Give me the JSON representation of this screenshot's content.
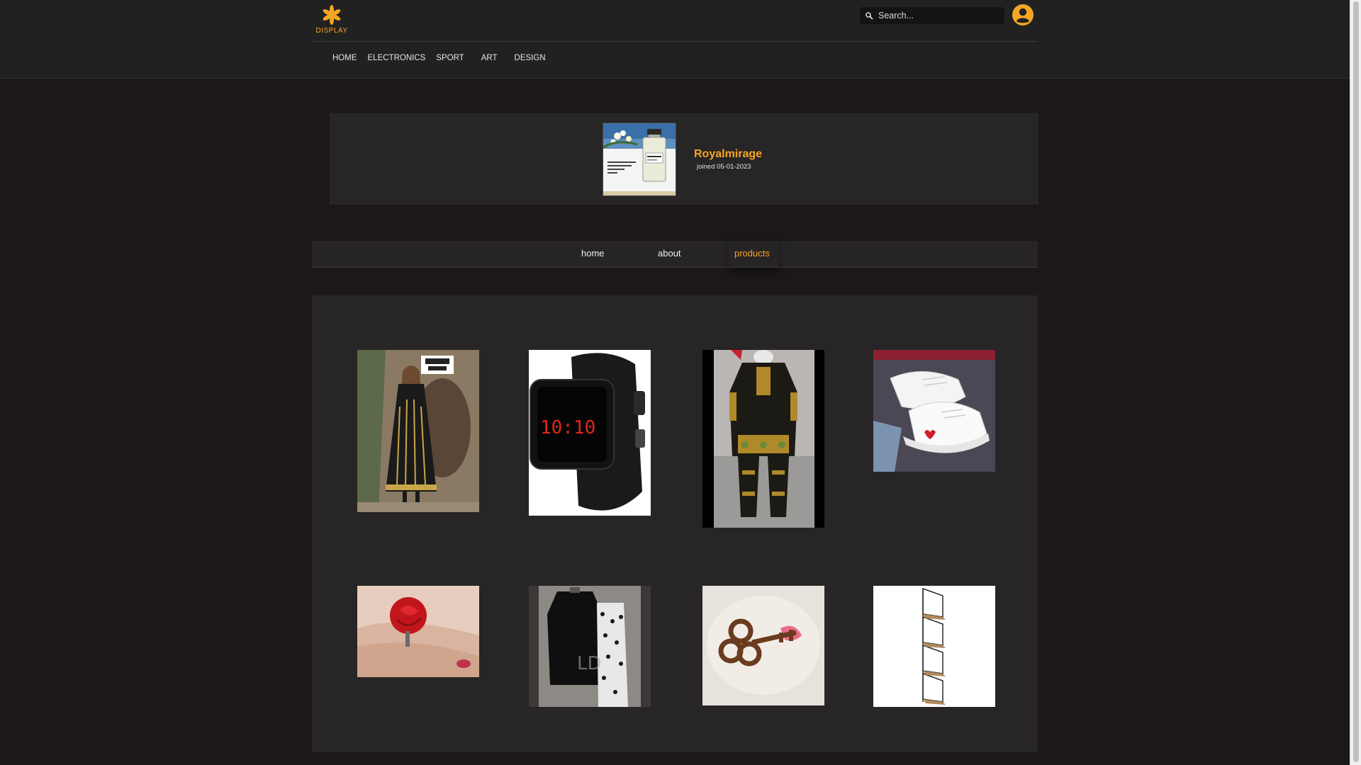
{
  "brand": {
    "logo_text": "DISPLAY",
    "accent": "#f5a623"
  },
  "nav": {
    "items": [
      "HOME",
      "ELECTRONICS",
      "SPORT",
      "ART",
      "DESIGN"
    ]
  },
  "search": {
    "placeholder": "Search..."
  },
  "profile": {
    "store_name": "Royalmirage",
    "joined": "joined 05-01-2023"
  },
  "tabs": [
    {
      "label": "home",
      "active": false
    },
    {
      "label": "about",
      "active": false
    },
    {
      "label": "products",
      "active": true
    }
  ],
  "products": [
    {
      "image": "black-embroidered-dress"
    },
    {
      "image": "black-digital-watch"
    },
    {
      "image": "printed-kurta-set"
    },
    {
      "image": "white-sneakers"
    },
    {
      "image": "red-rose-ring"
    },
    {
      "image": "black-suit-printed-pants"
    },
    {
      "image": "bronze-key-hook"
    },
    {
      "image": "corner-wall-shelf"
    }
  ]
}
